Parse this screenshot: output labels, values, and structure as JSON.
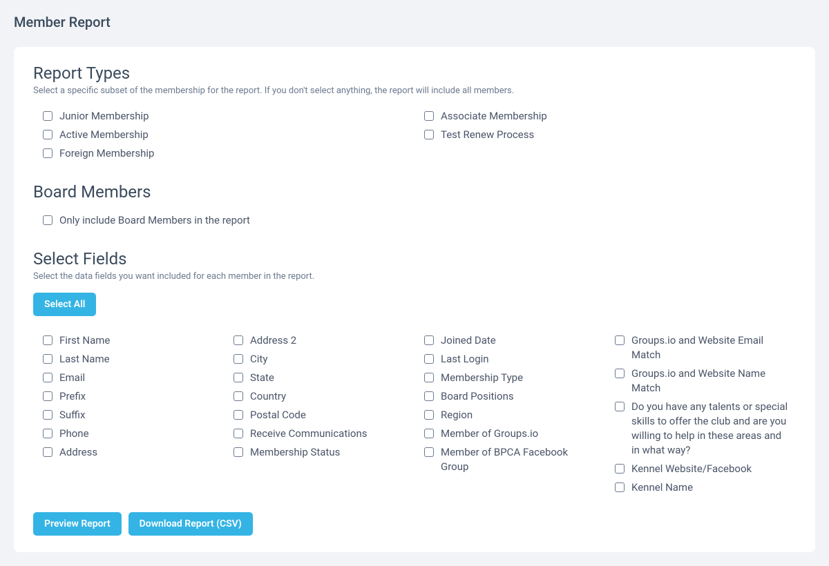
{
  "page_title": "Member Report",
  "report_types": {
    "title": "Report Types",
    "desc": "Select a specific subset of the membership for the report. If you don't select anything, the report will include all members.",
    "left": [
      "Junior Membership",
      "Active Membership",
      "Foreign Membership"
    ],
    "right": [
      "Associate Membership",
      "Test Renew Process"
    ]
  },
  "board_members": {
    "title": "Board Members",
    "option": "Only include Board Members in the report"
  },
  "select_fields": {
    "title": "Select Fields",
    "desc": "Select the data fields you want included for each member in the report.",
    "select_all_label": "Select All",
    "col1": [
      "First Name",
      "Last Name",
      "Email",
      "Prefix",
      "Suffix",
      "Phone",
      "Address"
    ],
    "col2": [
      "Address 2",
      "City",
      "State",
      "Country",
      "Postal Code",
      "Receive Communications",
      "Membership Status"
    ],
    "col3": [
      "Joined Date",
      "Last Login",
      "Membership Type",
      "Board Positions",
      "Region",
      "Member of Groups.io",
      "Member of BPCA Facebook Group"
    ],
    "col4": [
      "Groups.io and Website Email Match",
      "Groups.io and Website Name Match",
      "Do you have any talents or special skills to offer the club and are you willing to help in these areas and in what way?",
      "Kennel Website/Facebook",
      "Kennel Name"
    ]
  },
  "buttons": {
    "preview": "Preview Report",
    "download": "Download Report (CSV)"
  }
}
